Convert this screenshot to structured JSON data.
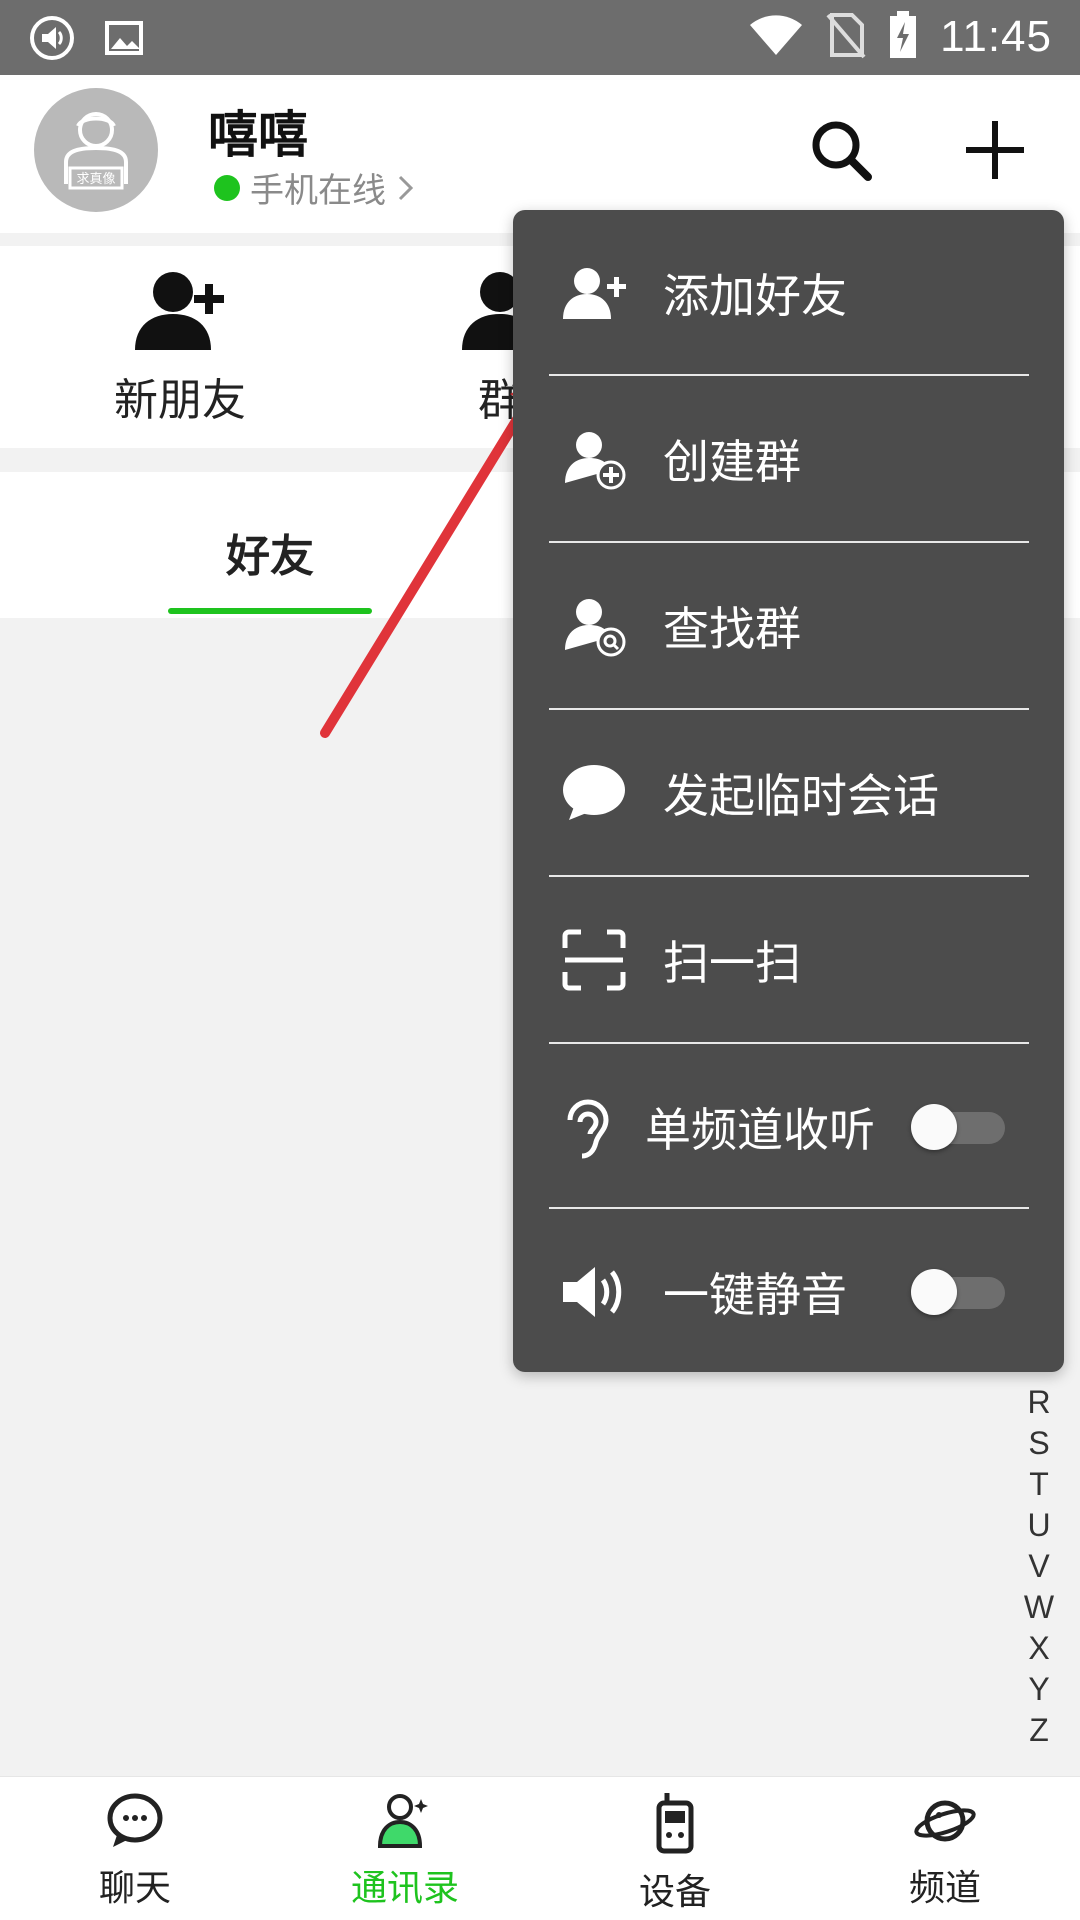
{
  "status_bar": {
    "time": "11:45",
    "icons": [
      "sound-notification-icon",
      "image-notification-icon",
      "wifi-icon",
      "no-sim-icon",
      "battery-charging-icon"
    ]
  },
  "header": {
    "avatar_text": "求真像",
    "username": "嘻嘻",
    "status": "手机在线",
    "status_color": "#1ec31e",
    "search_icon": "search-icon",
    "add_icon": "plus-icon"
  },
  "quick_actions": [
    {
      "label": "新朋友",
      "icon": "add-user-icon"
    },
    {
      "label": "群",
      "icon": "group-icon"
    }
  ],
  "tabs": [
    {
      "label": "好友",
      "active": true
    }
  ],
  "alphabet_index": [
    "R",
    "S",
    "T",
    "U",
    "V",
    "W",
    "X",
    "Y",
    "Z"
  ],
  "menu": {
    "items": [
      {
        "label": "添加好友",
        "icon": "add-friend-icon"
      },
      {
        "label": "创建群",
        "icon": "create-group-icon"
      },
      {
        "label": "查找群",
        "icon": "find-group-icon"
      },
      {
        "label": "发起临时会话",
        "icon": "chat-bubble-icon"
      },
      {
        "label": "扫一扫",
        "icon": "scan-icon"
      },
      {
        "label": "单频道收听",
        "icon": "ear-icon",
        "toggle": false
      },
      {
        "label": "一键静音",
        "icon": "speaker-icon",
        "toggle": false
      }
    ]
  },
  "bottom_nav": [
    {
      "label": "聊天",
      "icon": "chat-icon",
      "active": false
    },
    {
      "label": "通讯录",
      "icon": "contacts-icon",
      "active": true
    },
    {
      "label": "设备",
      "icon": "walkie-talkie-icon",
      "active": false
    },
    {
      "label": "频道",
      "icon": "planet-icon",
      "active": false
    }
  ],
  "colors": {
    "accent": "#1ec31e",
    "menu_bg": "#4c4c4c",
    "annotation_arrow": "#e0343a"
  }
}
